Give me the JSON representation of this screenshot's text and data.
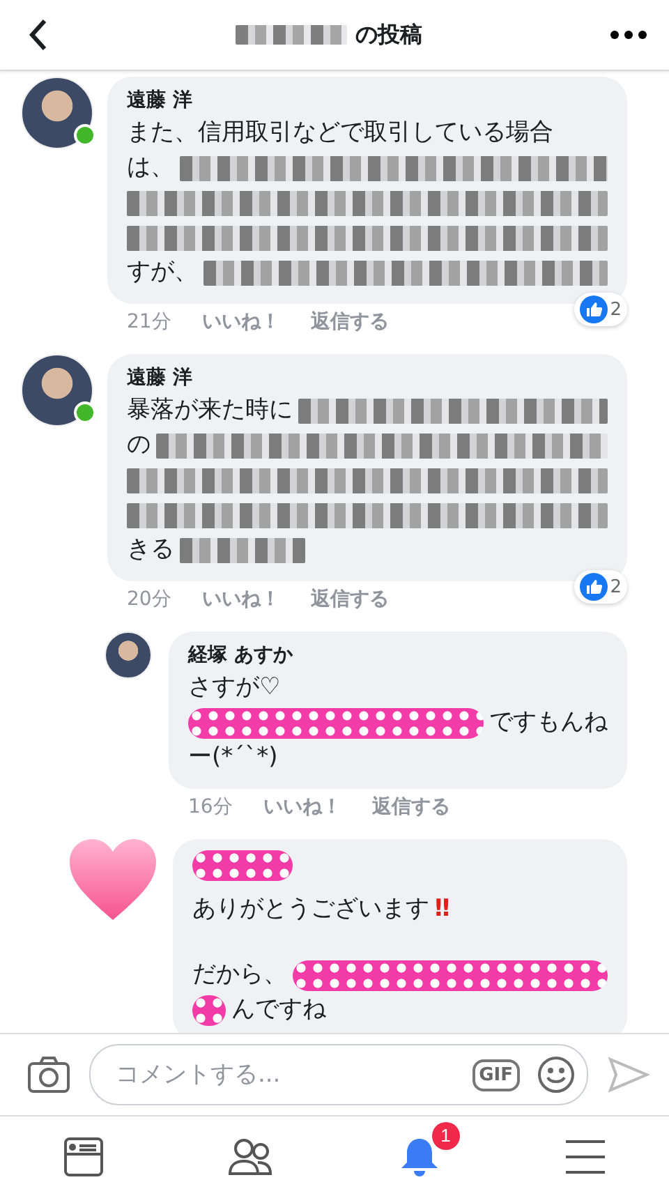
{
  "header": {
    "title": "の投稿"
  },
  "comments": [
    {
      "kind": "photo",
      "author": "遠藤 洋",
      "online": true,
      "reply": false,
      "lines": [
        {
          "kind": "line",
          "segments": [
            {
              "kind": "text",
              "text": "また、信用取引などで取引している場合"
            }
          ]
        },
        {
          "kind": "line",
          "segments": [
            {
              "kind": "text",
              "text": "は、"
            },
            {
              "kind": "pixelated"
            }
          ]
        },
        {
          "kind": "line",
          "segments": [
            {
              "kind": "pixelated"
            }
          ]
        },
        {
          "kind": "line",
          "segments": [
            {
              "kind": "pixelated"
            }
          ]
        },
        {
          "kind": "line",
          "segments": [
            {
              "kind": "text",
              "text": "すが、"
            },
            {
              "kind": "pixelated"
            }
          ]
        }
      ],
      "time": "21分",
      "like": "いいね！",
      "reply_label": "返信する",
      "reactions": "2"
    },
    {
      "kind": "photo",
      "author": "遠藤 洋",
      "online": true,
      "reply": false,
      "lines": [
        {
          "kind": "line",
          "segments": [
            {
              "kind": "text",
              "text": "暴落が来た時に"
            },
            {
              "kind": "pixelated"
            }
          ]
        },
        {
          "kind": "line",
          "segments": [
            {
              "kind": "text",
              "text": "の"
            },
            {
              "kind": "pixelated"
            }
          ]
        },
        {
          "kind": "line",
          "segments": [
            {
              "kind": "pixelated"
            }
          ]
        },
        {
          "kind": "line",
          "segments": [
            {
              "kind": "pixelated"
            }
          ]
        },
        {
          "kind": "line",
          "segments": [
            {
              "kind": "text",
              "text": "きる"
            },
            {
              "kind": "pixelated-short"
            }
          ]
        }
      ],
      "time": "20分",
      "like": "いいね！",
      "reply_label": "返信する",
      "reactions": "2"
    },
    {
      "kind": "photo",
      "author": "経塚 あすか",
      "online": false,
      "reply": true,
      "lines": [
        {
          "kind": "line",
          "segments": [
            {
              "kind": "text",
              "text": "さすが♡"
            }
          ]
        },
        {
          "kind": "line",
          "segments": [
            {
              "kind": "dots"
            },
            {
              "kind": "text",
              "text": "ですもんね"
            }
          ]
        },
        {
          "kind": "line",
          "segments": [
            {
              "kind": "text",
              "text": "ー(*´`*)"
            }
          ]
        }
      ],
      "time": "16分",
      "like": "いいね！",
      "reply_label": "返信する"
    },
    {
      "kind": "heart",
      "online": false,
      "reply": true,
      "name_hidden": true,
      "lines": [
        {
          "kind": "line",
          "segments": [
            {
              "kind": "text",
              "text": "ありがとうございます"
            },
            {
              "kind": "emphasis",
              "text": "‼"
            }
          ]
        },
        {
          "kind": "blank"
        },
        {
          "kind": "line",
          "segments": [
            {
              "kind": "text",
              "text": "だから、"
            },
            {
              "kind": "dots"
            }
          ]
        },
        {
          "kind": "line",
          "segments": [
            {
              "kind": "dots-short"
            },
            {
              "kind": "text",
              "text": "んですね"
            }
          ]
        }
      ]
    }
  ],
  "composer": {
    "placeholder": "コメントする...",
    "gif": "GIF"
  },
  "tabs": [
    {
      "selected": false
    },
    {
      "selected": false
    },
    {
      "selected": true,
      "badge": "1"
    },
    {
      "selected": false
    }
  ]
}
